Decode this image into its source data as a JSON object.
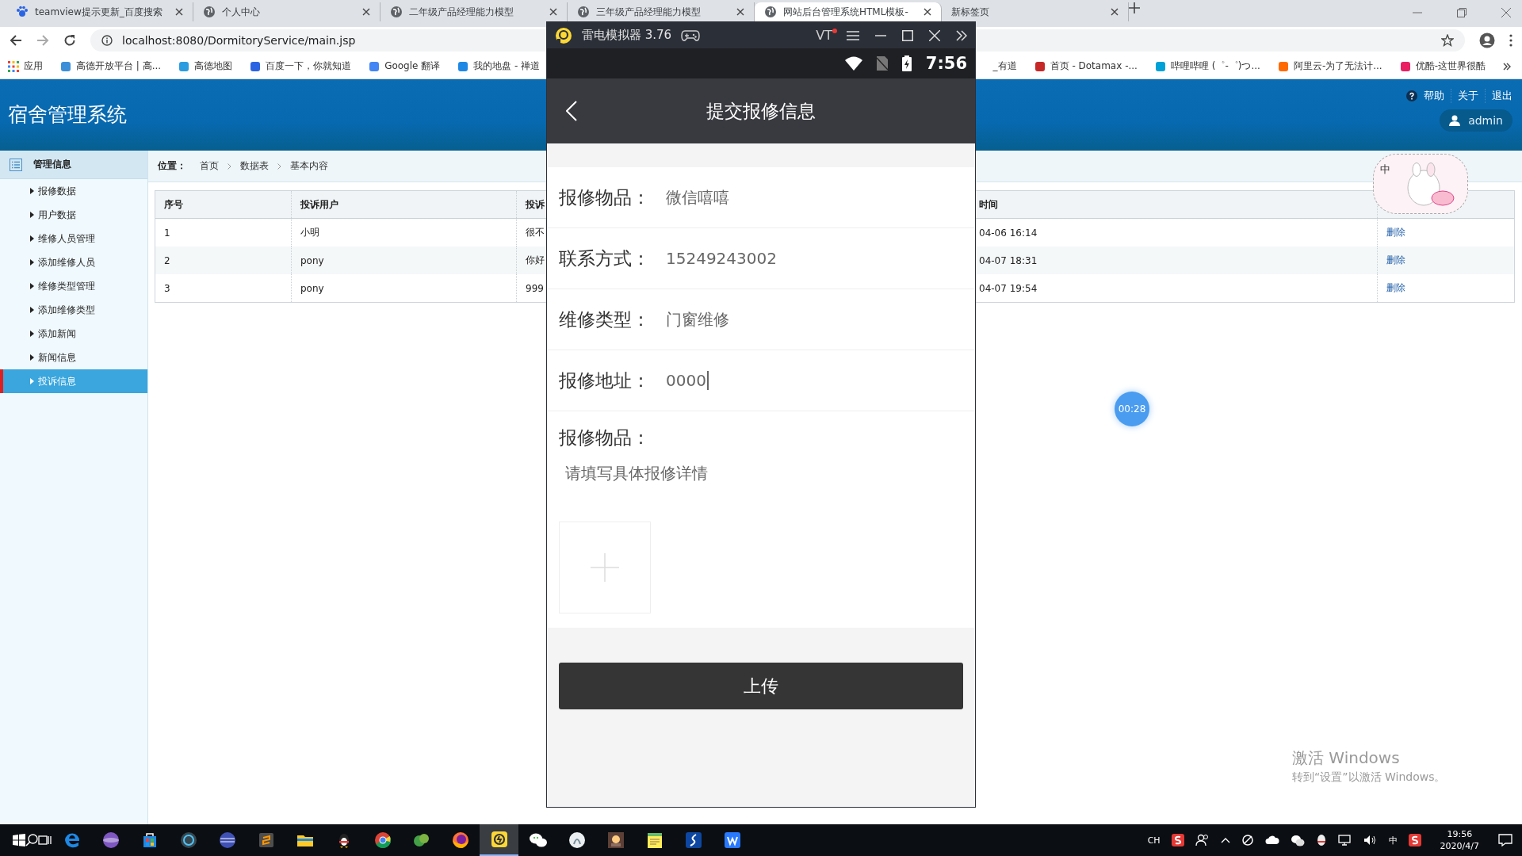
{
  "browser": {
    "tabs": [
      {
        "title": "teamview提示更新_百度搜索",
        "selected": false
      },
      {
        "title": "个人中心",
        "selected": false
      },
      {
        "title": "二年级产品经理能力模型",
        "selected": false
      },
      {
        "title": "三年级产品经理能力模型",
        "selected": false
      },
      {
        "title": "网站后台管理系统HTML模板-",
        "selected": true
      },
      {
        "title": "新标签页",
        "selected": false
      }
    ],
    "address": "localhost:8080/DormitoryService/main.jsp",
    "bookmarks_left": [
      "应用",
      "高德开放平台 | 高...",
      "高德地图",
      "百度一下，你就知道",
      "Google 翻译",
      "我的地盘 - 禅道"
    ],
    "bookmarks_right": [
      "_有道",
      "首页 - Dotamax -...",
      "哔哩哔哩 (゜-゜)つ...",
      "阿里云-为了无法计...",
      "优酷-这世界很酷"
    ]
  },
  "site": {
    "title": "宿舍管理系统",
    "top_links": [
      "帮助",
      "关于",
      "退出"
    ],
    "user": "admin",
    "sidebar": {
      "heading": "管理信息",
      "items": [
        {
          "label": "报修数据",
          "selected": false
        },
        {
          "label": "用户数据",
          "selected": false
        },
        {
          "label": "维修人员管理",
          "selected": false
        },
        {
          "label": "添加维修人员",
          "selected": false
        },
        {
          "label": "维修类型管理",
          "selected": false
        },
        {
          "label": "添加维修类型",
          "selected": false
        },
        {
          "label": "添加新闻",
          "selected": false
        },
        {
          "label": "新闻信息",
          "selected": false
        },
        {
          "label": "投诉信息",
          "selected": true
        }
      ]
    },
    "breadcrumb": {
      "label": "位置：",
      "items": [
        "首页",
        "数据表",
        "基本内容"
      ]
    },
    "table": {
      "columns": [
        "序号",
        "投诉用户",
        "投诉",
        "时间"
      ],
      "rows": [
        {
          "cells": [
            "1",
            "小明",
            "很不",
            "04-06 16:14"
          ],
          "action": "删除"
        },
        {
          "cells": [
            "2",
            "pony",
            "你好",
            "04-07 18:31"
          ],
          "action": "删除"
        },
        {
          "cells": [
            "3",
            "pony",
            "999",
            "04-07 19:54"
          ],
          "action": "删除"
        }
      ]
    }
  },
  "ime_widget": {
    "label": "中"
  },
  "timer_badge": "00:28",
  "emulator": {
    "title": "雷电模拟器 3.76",
    "vt": "VT",
    "clock": "7:56",
    "screen_title": "提交报修信息",
    "fields": [
      {
        "label": "报修物品：",
        "value": "微信嘻嘻",
        "focused": false
      },
      {
        "label": "联系方式：",
        "value": "15249243002",
        "focused": false
      },
      {
        "label": "维修类型：",
        "value": "门窗维修",
        "focused": false
      },
      {
        "label": "报修地址：",
        "value": "0000",
        "focused": true
      }
    ],
    "details": {
      "label": "报修物品：",
      "placeholder": "请填写具体报修详情"
    },
    "submit": "上传"
  },
  "activation_notice": {
    "title": "激活 Windows",
    "text": "转到“设置”以激活 Windows。"
  },
  "taskbar": {
    "apps": [
      {
        "selected": false
      },
      {
        "selected": false
      },
      {
        "selected": false
      },
      {
        "selected": false
      },
      {
        "selected": false
      },
      {
        "selected": false
      },
      {
        "selected": false
      },
      {
        "selected": false
      },
      {
        "selected": false
      },
      {
        "selected": false
      },
      {
        "selected": false
      },
      {
        "selected": true
      },
      {
        "selected": false
      },
      {
        "selected": false
      },
      {
        "selected": false
      },
      {
        "selected": false
      },
      {
        "selected": false
      },
      {
        "selected": false
      }
    ],
    "ime": "CH",
    "lang": "中",
    "time": "19:56",
    "date": "2020/4/7"
  }
}
